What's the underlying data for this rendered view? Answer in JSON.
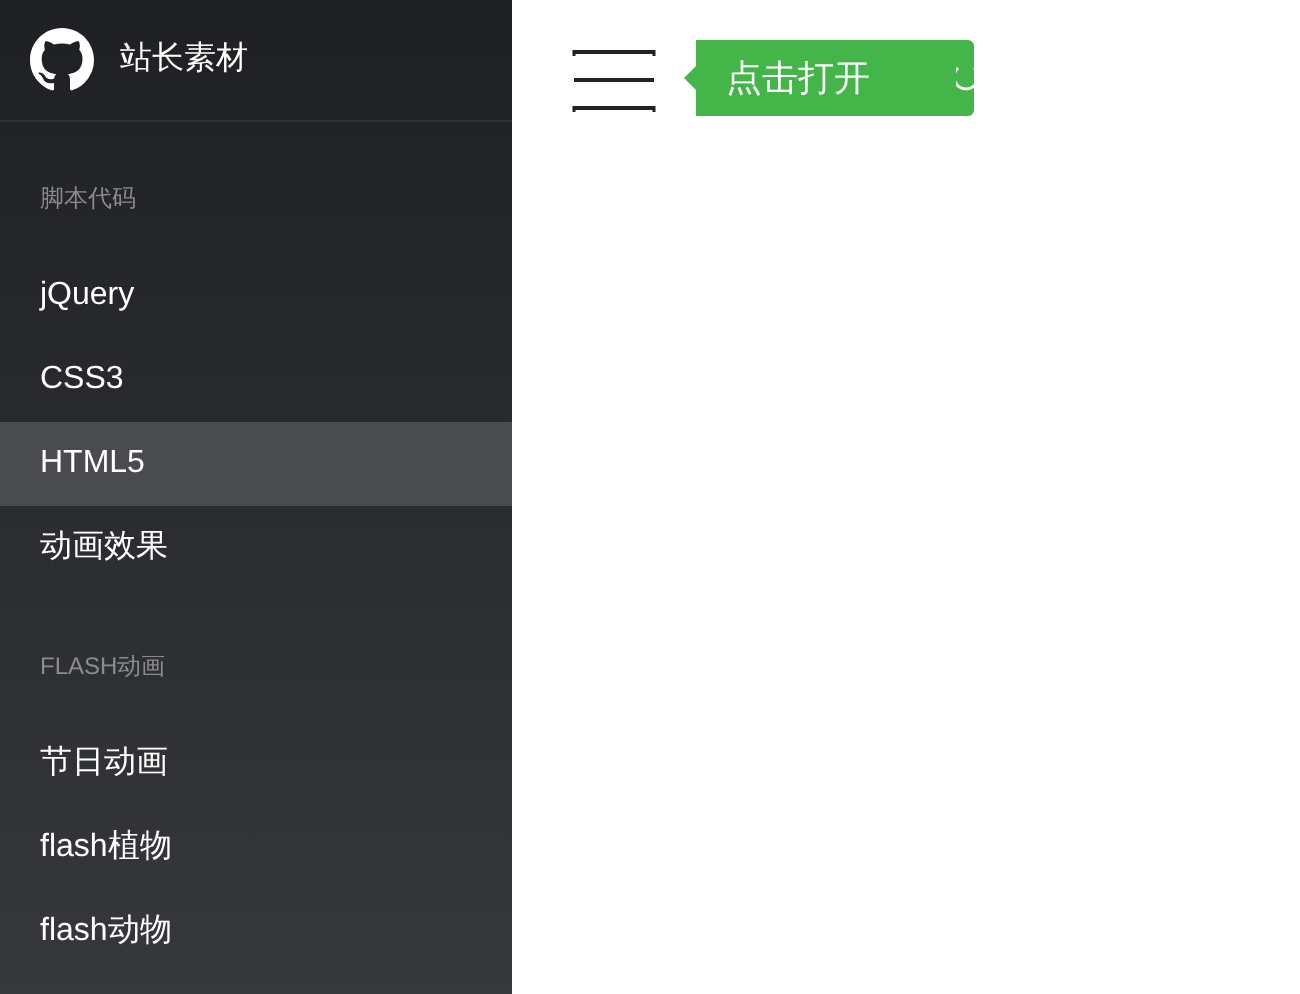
{
  "sidebar": {
    "brand": "站长素材",
    "sections": [
      {
        "title": "脚本代码",
        "items": [
          {
            "label": "jQuery",
            "selected": false
          },
          {
            "label": "CSS3",
            "selected": false
          },
          {
            "label": "HTML5",
            "selected": true
          },
          {
            "label": "动画效果",
            "selected": false
          }
        ]
      },
      {
        "title": "FLASH动画",
        "items": [
          {
            "label": "节日动画",
            "selected": false
          },
          {
            "label": "flash植物",
            "selected": false
          },
          {
            "label": "flash动物",
            "selected": false
          }
        ]
      }
    ]
  },
  "toolbar": {
    "open_button": "点击打开"
  }
}
